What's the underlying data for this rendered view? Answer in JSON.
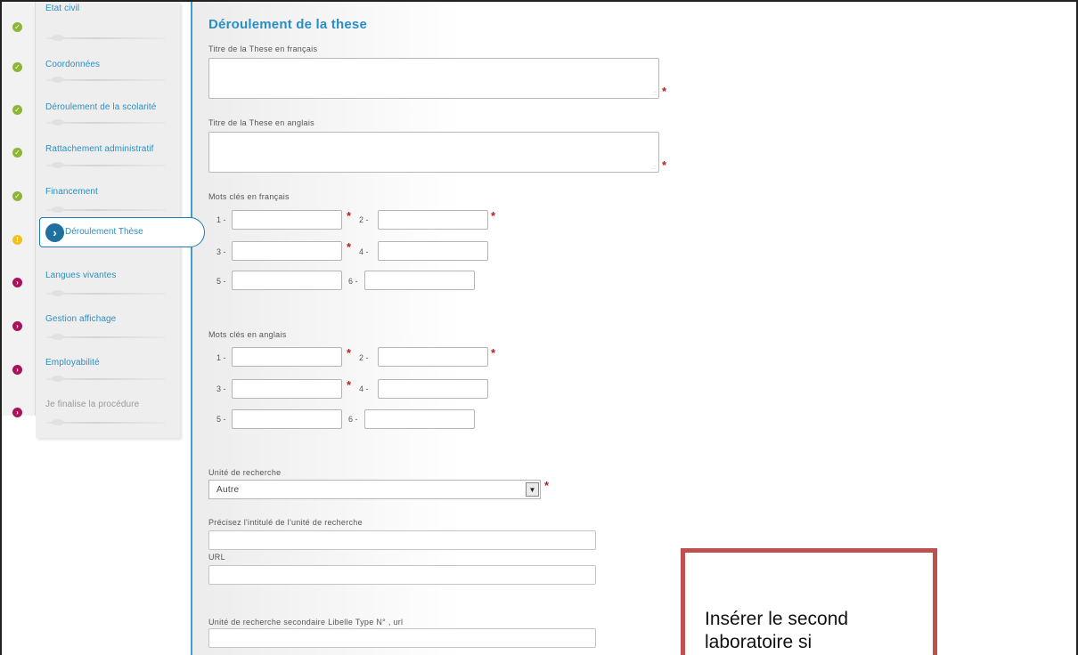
{
  "sidebar": {
    "items": [
      {
        "label": "Etat civil",
        "status": "done"
      },
      {
        "label": "Coordonnées",
        "status": "done"
      },
      {
        "label": "Déroulement de la scolarité",
        "status": "done"
      },
      {
        "label": "Rattachement administratif",
        "status": "done"
      },
      {
        "label": "Financement",
        "status": "done"
      },
      {
        "label": "Déroulement Thèse",
        "status": "current",
        "active": true
      },
      {
        "label": "Langues vivantes",
        "status": "todo"
      },
      {
        "label": "Gestion affichage",
        "status": "todo"
      },
      {
        "label": "Employabilité",
        "status": "todo"
      },
      {
        "label": "Je finalise la procédure",
        "status": "todo",
        "disabled": true
      }
    ],
    "status_icons": {
      "done": "check-icon",
      "current": "exclamation-icon",
      "todo": "chevron-right-icon"
    },
    "status_colors": {
      "done": "#8cb53a",
      "current": "#f0c020",
      "todo": "#a6155a"
    },
    "accent_color": "#2d8fc0"
  },
  "form": {
    "title": "Déroulement de la these",
    "thesis_title_fr": {
      "label": "Titre de la These en français",
      "value": "",
      "required": true
    },
    "thesis_title_en": {
      "label": "Titre de la These en anglais",
      "value": "",
      "required": true
    },
    "keywords_fr": {
      "label": "Mots clés en français",
      "fields": [
        {
          "num": "1 -",
          "value": "",
          "required": true
        },
        {
          "num": "2 -",
          "value": "",
          "required": true
        },
        {
          "num": "3 -",
          "value": "",
          "required": true
        },
        {
          "num": "4 -",
          "value": "",
          "required": false
        },
        {
          "num": "5 -",
          "value": "",
          "required": false
        },
        {
          "num": "6 -",
          "value": "",
          "required": false
        }
      ]
    },
    "keywords_en": {
      "label": "Mots clés en anglais",
      "fields": [
        {
          "num": "1 -",
          "value": "",
          "required": true
        },
        {
          "num": "2 -",
          "value": "",
          "required": true
        },
        {
          "num": "3 -",
          "value": "",
          "required": true
        },
        {
          "num": "4 -",
          "value": "",
          "required": false
        },
        {
          "num": "5 -",
          "value": "",
          "required": false
        },
        {
          "num": "6 -",
          "value": "",
          "required": false
        }
      ]
    },
    "research_unit": {
      "label": "Unité de recherche",
      "selected": "Autre",
      "required": true
    },
    "research_unit_name": {
      "label": "Précisez l'intitulé de l'unité de recherche",
      "value": ""
    },
    "url": {
      "label": "URL",
      "value": ""
    },
    "secondary_unit": {
      "label": "Unité de recherche secondaire Libelle Type N° , url",
      "value": ""
    },
    "required_marker": "*"
  },
  "annotation": {
    "text": "Insérer le second laboratoire si",
    "border_color": "#c0504d"
  }
}
